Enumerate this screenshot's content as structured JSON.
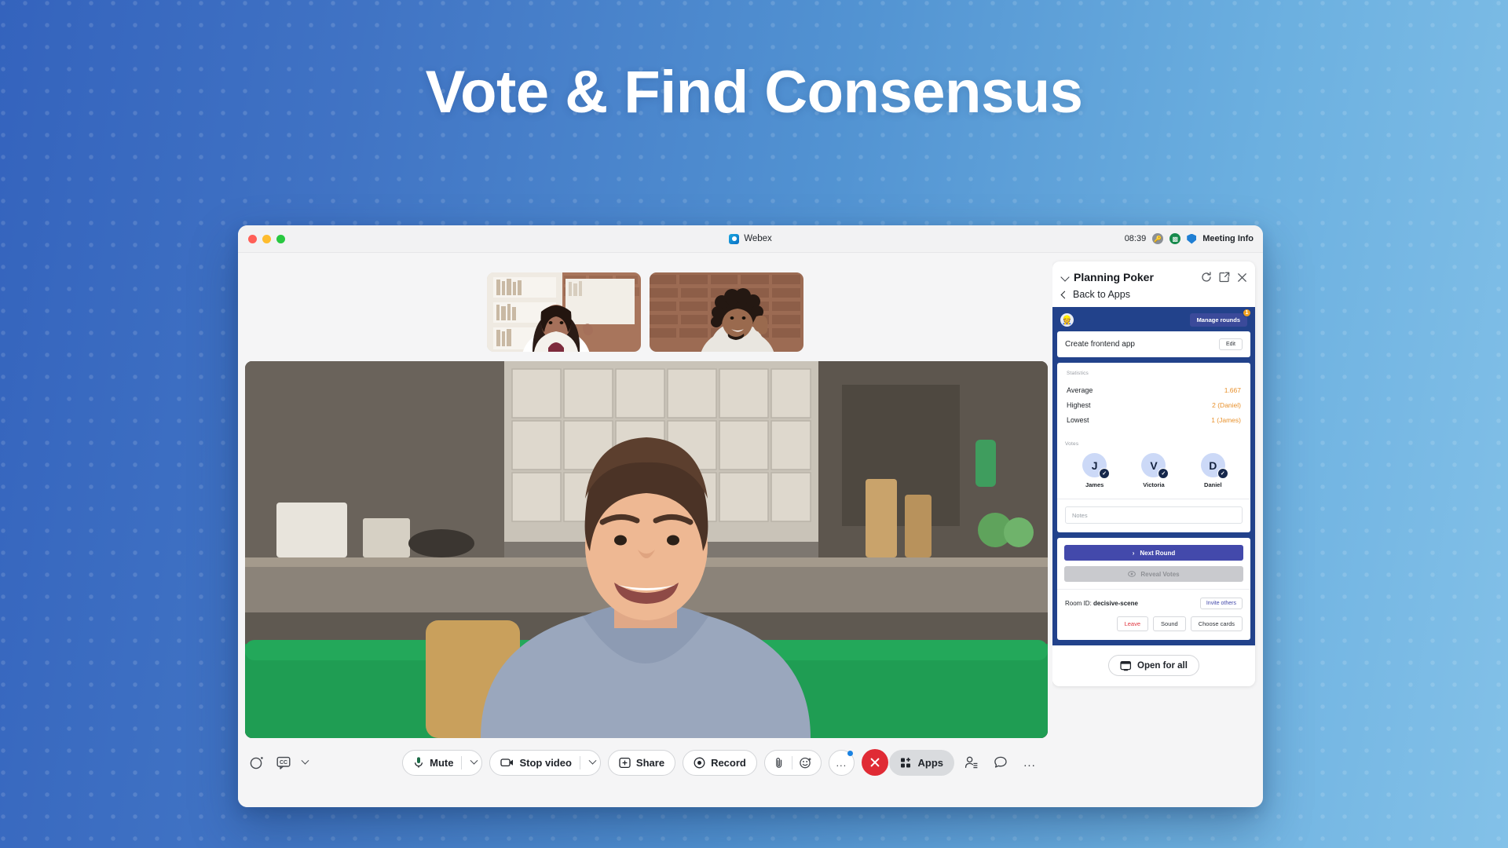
{
  "hero": {
    "title": "Vote & Find Consensus"
  },
  "window": {
    "titlebar": {
      "app_name": "Webex",
      "clock": "08:39",
      "meeting_info_label": "Meeting Info"
    }
  },
  "toolbar": {
    "left": {
      "reaction_icon": "reaction-circle-icon",
      "captions_icon": "closed-captions-icon",
      "more_chevron_icon": "chevron-down-icon"
    },
    "mute_label": "Mute",
    "video_label": "Stop video",
    "share_label": "Share",
    "record_label": "Record",
    "more_label": "...",
    "apps_label": "Apps",
    "end_call_icon": "end-call-icon"
  },
  "panel": {
    "title": "Planning Poker",
    "back_label": "Back to Apps",
    "actions": {
      "refresh": "refresh-icon",
      "popout": "open-in-new-icon",
      "close": "close-icon"
    },
    "open_for_all_label": "Open for all"
  },
  "app": {
    "manage_rounds_label": "Manage rounds",
    "manage_rounds_badge": "1",
    "avatar_emoji": "👷",
    "task": {
      "name": "Create frontend app",
      "edit_label": "Edit"
    },
    "statistics": {
      "section_label": "Statistics",
      "rows": [
        {
          "label": "Average",
          "value": "1.667"
        },
        {
          "label": "Highest",
          "value": "2 (Daniel)"
        },
        {
          "label": "Lowest",
          "value": "1 (James)"
        }
      ]
    },
    "votes": {
      "section_label": "Votes",
      "voters": [
        {
          "initial": "J",
          "name": "James",
          "voted": true
        },
        {
          "initial": "V",
          "name": "Victoria",
          "voted": true
        },
        {
          "initial": "D",
          "name": "Daniel",
          "voted": true
        }
      ]
    },
    "notes_placeholder": "Notes",
    "next_round_label": "Next Round",
    "reveal_votes_label": "Reveal Votes",
    "room_id_prefix": "Room ID: ",
    "room_id": "decisive-scene",
    "invite_label": "Invite others",
    "footer": {
      "leave": "Leave",
      "sound": "Sound",
      "choose_cards": "Choose cards"
    }
  },
  "colors": {
    "app_header_blue": "#22428b",
    "primary_button": "#4349ab",
    "stat_value_orange": "#e8912c",
    "badge_orange": "#f0a020",
    "end_call_red": "#e02b35",
    "leave_red": "#e0353f"
  }
}
